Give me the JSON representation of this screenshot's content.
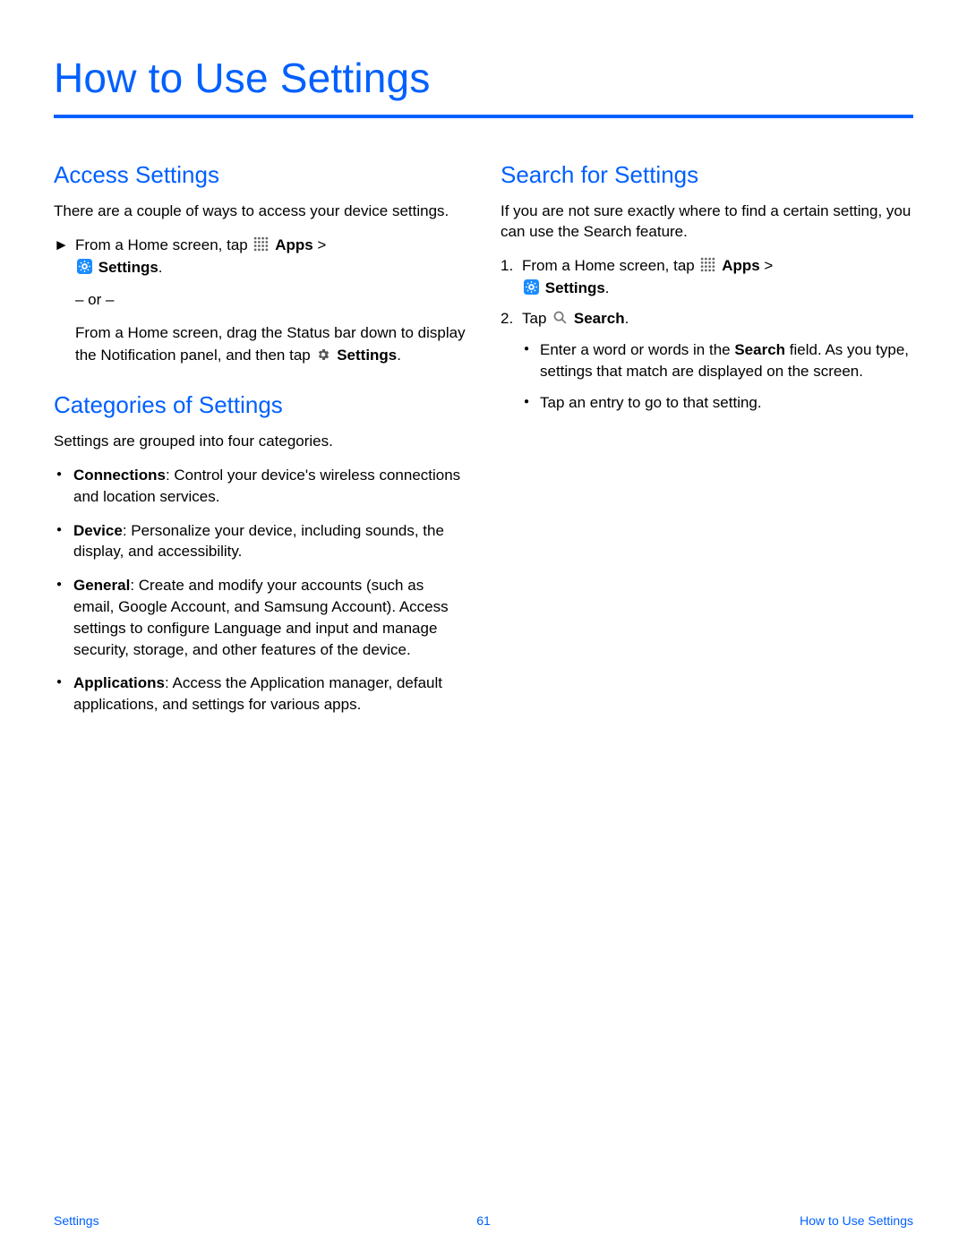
{
  "title": "How to Use Settings",
  "left": {
    "h_access": "Access Settings",
    "access_intro": "There are a couple of ways to access your device settings.",
    "step1_pre": "From a Home screen, tap ",
    "apps_label": "Apps",
    "gt": " > ",
    "settings_label": "Settings",
    "period": ".",
    "or_text": "– or –",
    "step1_alt_pre": "From a Home screen, drag the Status bar down to display the Notification panel, and then tap ",
    "h_categories": "Categories of Settings",
    "cat_intro": "Settings are grouped into four categories.",
    "cat1_label": "Connections",
    "cat1_text": ": Control your device's wireless connections and location services.",
    "cat2_label": "Device",
    "cat2_text": ": Personalize your device, including sounds, the display, and accessibility.",
    "cat3_label": "General",
    "cat3_text": ": Create and modify your accounts (such as email, Google Account, and Samsung Account). Access settings to configure Language and input and manage security, storage, and other features of the device.",
    "cat4_label": "Applications",
    "cat4_text": ": Access the Application manager, default applications, and settings for various apps."
  },
  "right": {
    "h_search": "Search for Settings",
    "search_intro": "If you are not sure exactly where to find a certain setting, you can use the Search feature.",
    "num1": "1.",
    "step1_pre": "From a Home screen, tap ",
    "num2": "2.",
    "step2_pre": "Tap ",
    "search_label": "Search",
    "sub1_pre": "Enter a word or words in the ",
    "sub1_bold": "Search",
    "sub1_post": " field. As you type, settings that match are displayed on the screen.",
    "sub2": "Tap an entry to go to that setting."
  },
  "footer": {
    "left": "Settings",
    "center": "61",
    "right": "How to Use Settings"
  }
}
